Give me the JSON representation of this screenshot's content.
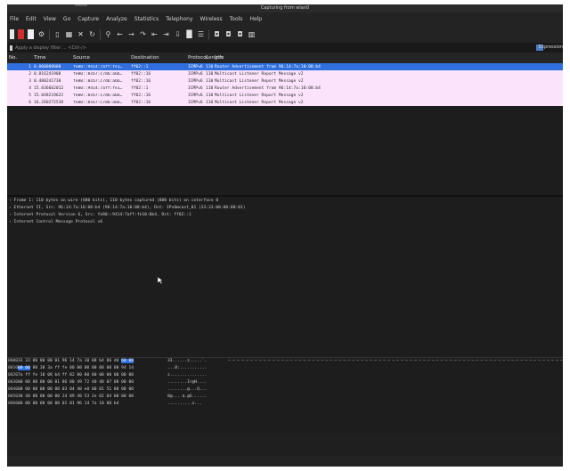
{
  "window": {
    "title": "Capturing from wlan0"
  },
  "menu": [
    "File",
    "Edit",
    "View",
    "Go",
    "Capture",
    "Analyze",
    "Statistics",
    "Telephony",
    "Wireless",
    "Tools",
    "Help"
  ],
  "filter": {
    "placeholder": "Apply a display filter ... <Ctrl-/>",
    "expression_label": "Expression"
  },
  "columns": {
    "no": "No.",
    "time": "Time",
    "source": "Source",
    "destination": "Destination",
    "protocol": "Protocol",
    "length": "Length",
    "info": "Info"
  },
  "packets": [
    {
      "no": "1",
      "time": "0.000000000",
      "src": "fe80::9414:7aff:fe1…",
      "dst": "ff02::1",
      "proto": "ICMPv6",
      "len": "110",
      "info": "Router Advertisement from 96:14:7a:10:08:b4",
      "selected": true
    },
    {
      "no": "2",
      "time": "0.816241908",
      "src": "fe80::8cb7:c7d6:a6b…",
      "dst": "ff02::16",
      "proto": "ICMPv6",
      "len": "110",
      "info": "Multicast Listener Report Message v2",
      "selected": false
    },
    {
      "no": "3",
      "time": "0.480241730",
      "src": "fe80::8cb7:c7d6:a6b…",
      "dst": "ff02::16",
      "proto": "ICMPv6",
      "len": "110",
      "info": "Multicast Listener Report Message v2",
      "selected": false
    },
    {
      "no": "4",
      "time": "15.836662012",
      "src": "fe80::9414:7aff:fe1…",
      "dst": "ff02::1",
      "proto": "ICMPv6",
      "len": "110",
      "info": "Router Advertisement from 96:14:7a:10:08:b4",
      "selected": false
    },
    {
      "no": "5",
      "time": "15.848219622",
      "src": "fe80::8cb7:c7d6:a6b…",
      "dst": "ff02::16",
      "proto": "ICMPv6",
      "len": "110",
      "info": "Multicast Listener Report Message v2",
      "selected": false
    },
    {
      "no": "6",
      "time": "16.260272538",
      "src": "fe80::8cb7:c7d6:a6b…",
      "dst": "ff02::16",
      "proto": "ICMPv6",
      "len": "110",
      "info": "Multicast Listener Report Message v2",
      "selected": false
    }
  ],
  "details": [
    "Frame 1: 110 bytes on wire (880 bits), 110 bytes captured (880 bits) on interface 0",
    "Ethernet II, Src: 96:14:7a:10:08:b4 (96:14:7a:10:08:b4), Dst: IPv6mcast_01 (33:33:00:00:00:01)",
    "Internet Protocol Version 6, Src: fe80::9414:7aff:fe10:8b4, Dst: ff02::1",
    "Internet Control Message Protocol v6"
  ],
  "bytes": [
    {
      "off": "0000",
      "hex": "33 33 00 00 00 01 96 14  7a 10 08 b4 86 dd 60 00",
      "ascii": "33......z.....`."
    },
    {
      "off": "0010",
      "hex": "00 00 00 38 3a ff fe 80  00 00 00 00 00 00 94 14",
      "ascii": "...8:..........."
    },
    {
      "off": "0020",
      "hex": "7a ff fe 10 08 b4 ff 02  00 00 00 00 00 00 00 00",
      "ascii": "z..............."
    },
    {
      "off": "0030",
      "hex": "00 00 00 00 00 01 86 00  49 72 40 48 07 08 00 00",
      "ascii": "........Ir@H...."
    },
    {
      "off": "0040",
      "hex": "00 00 00 00 00 00 03 04  40 e0 00 01 51 80 00 00",
      "ascii": "........@...Q..."
    },
    {
      "off": "0050",
      "hex": "38 40 00 00 00 00 24 09  40 53 2e 02 04 00 00 00",
      "ascii": "8@....$.@S......"
    },
    {
      "off": "0060",
      "hex": "00 00 00 00 00 00 01 01  96 14 7a 10 08 b4",
      "ascii": "..........z..."
    }
  ],
  "colors": {
    "selected_row": "#2f6fde",
    "icmp_row": "#fbe4fb",
    "stop_button": "#d12b2b"
  }
}
